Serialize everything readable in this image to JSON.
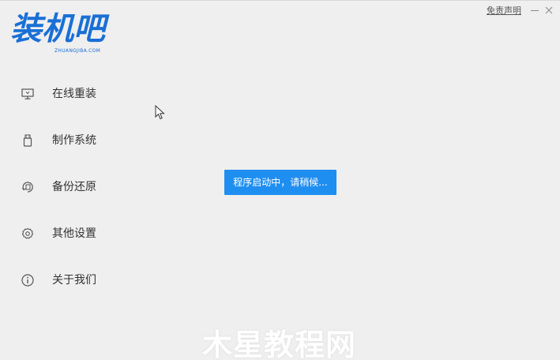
{
  "app": {
    "logo_text": "装机吧",
    "logo_subtext": "ZHUANGJIBA.COM",
    "brand_color": "#1a6fd6"
  },
  "titlebar": {
    "disclaimer_label": "免责声明",
    "minimize_icon": "minimize-icon",
    "close_icon": "close-icon"
  },
  "sidebar": {
    "items": [
      {
        "label": "在线重装",
        "icon": "monitor-icon"
      },
      {
        "label": "制作系统",
        "icon": "usb-drive-icon"
      },
      {
        "label": "备份还原",
        "icon": "backup-restore-icon"
      },
      {
        "label": "其他设置",
        "icon": "gear-icon"
      },
      {
        "label": "关于我们",
        "icon": "info-icon"
      }
    ]
  },
  "main": {
    "toast_text": "程序启动中，请稍候...",
    "toast_color": "#1f8ef1"
  },
  "watermark": {
    "text": "木星教程网"
  }
}
